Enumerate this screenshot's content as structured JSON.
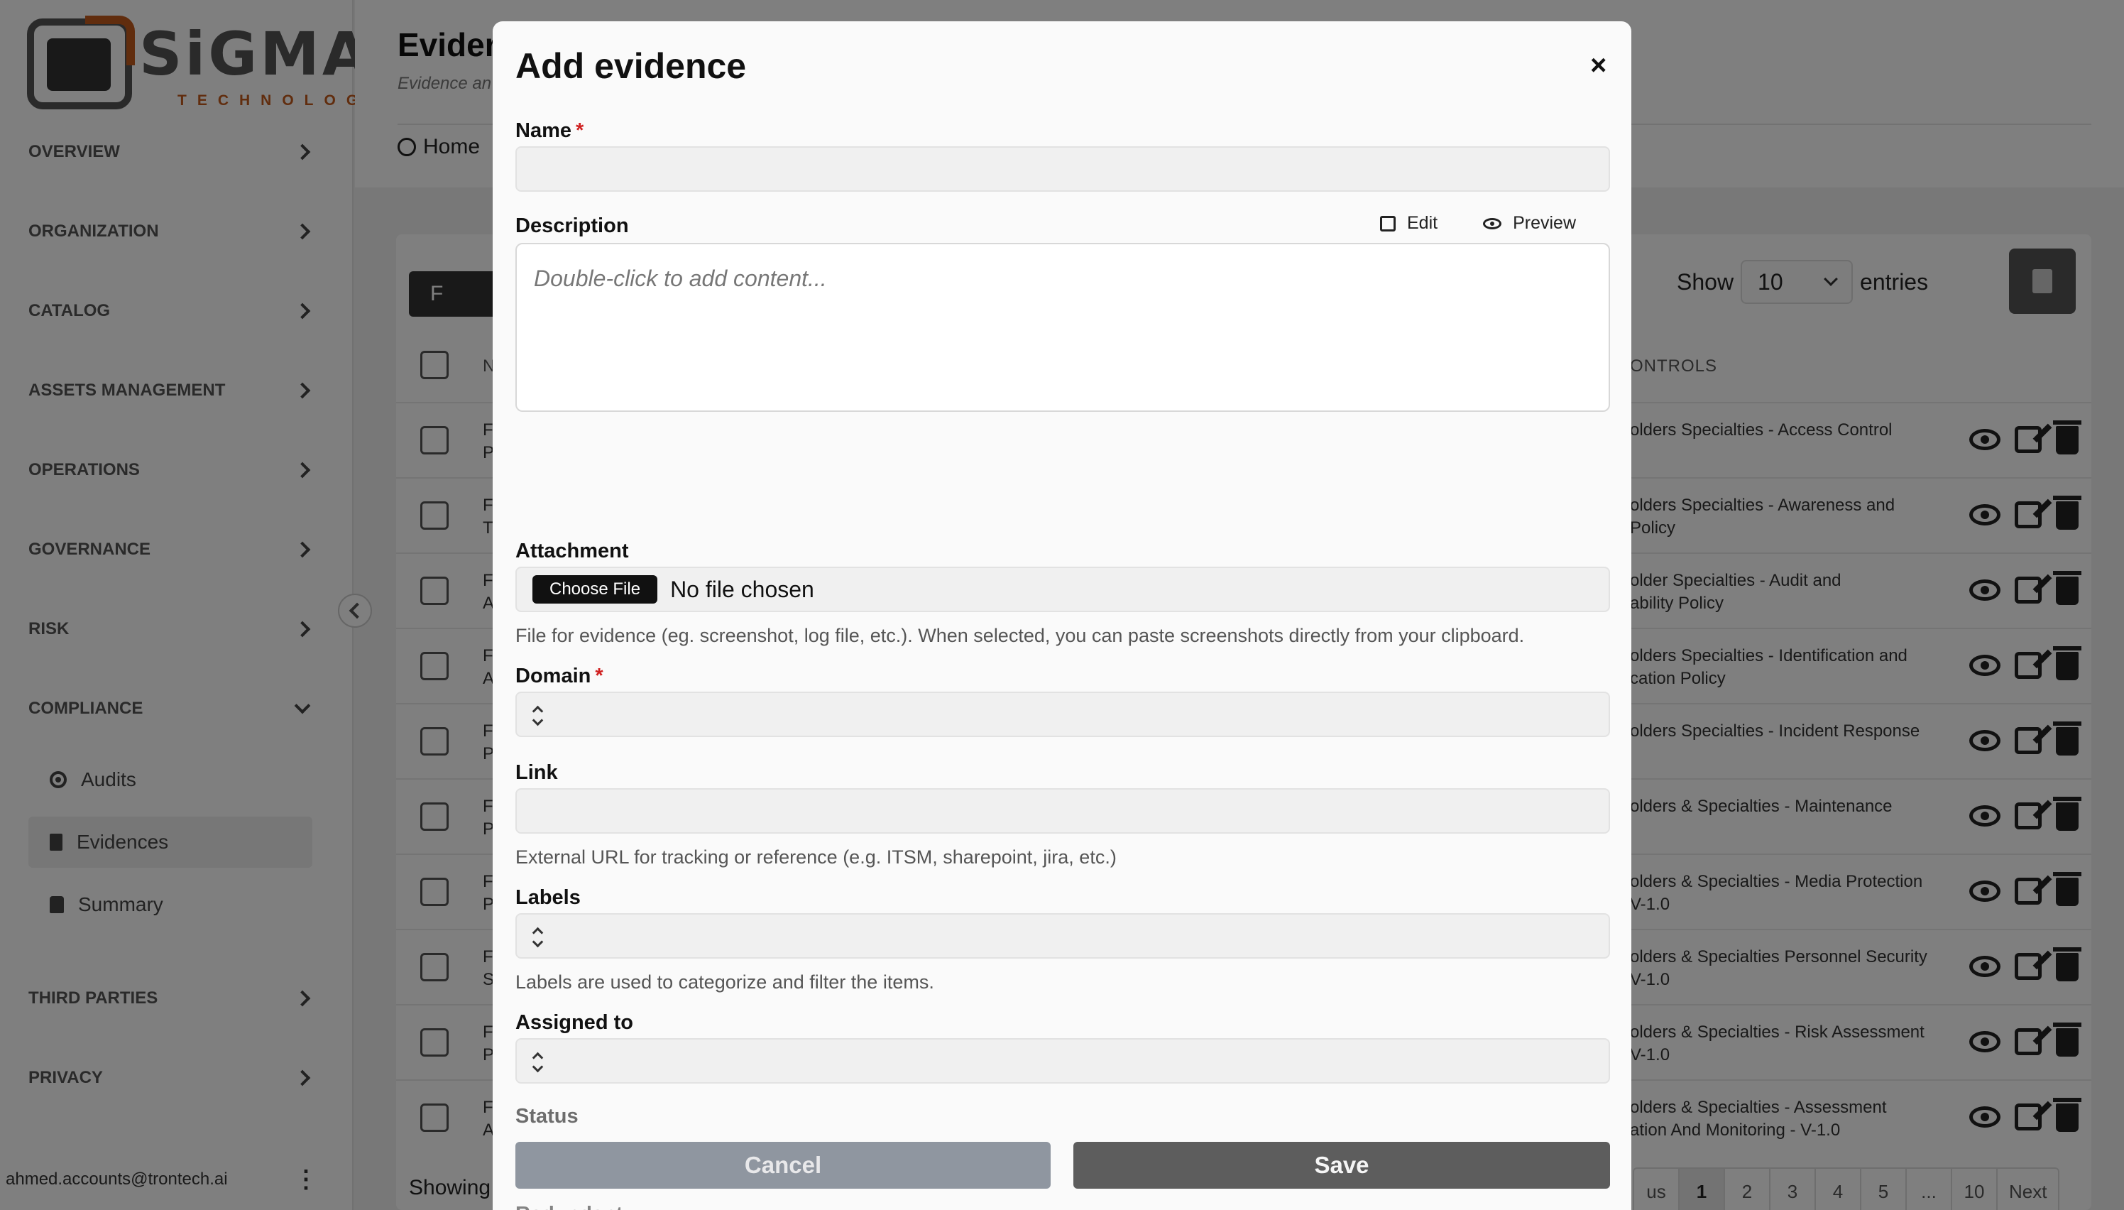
{
  "brand": {
    "name": "SiGMA",
    "sub": "TECHNOLOGY"
  },
  "sidebar": {
    "items": [
      {
        "label": "OVERVIEW"
      },
      {
        "label": "ORGANIZATION"
      },
      {
        "label": "CATALOG"
      },
      {
        "label": "ASSETS MANAGEMENT"
      },
      {
        "label": "OPERATIONS"
      },
      {
        "label": "GOVERNANCE"
      },
      {
        "label": "RISK"
      },
      {
        "label": "COMPLIANCE"
      },
      {
        "label": "THIRD PARTIES"
      },
      {
        "label": "PRIVACY"
      }
    ],
    "compliance_sub": [
      {
        "label": "Audits"
      },
      {
        "label": "Evidences"
      },
      {
        "label": "Summary"
      }
    ],
    "user_email": "ahmed.accounts@trontech.ai"
  },
  "page": {
    "title": "Evider",
    "subtitle": "Evidence an",
    "breadcrumb": "Home"
  },
  "table": {
    "filter_label": "F",
    "show_label": "Show",
    "show_value": "10",
    "entries_label": "entries",
    "col_name": "N",
    "col_controls": "ONTROLS",
    "rows": [
      {
        "n1": "F",
        "n2": "P",
        "c1": "olders Specialties - Access Control",
        "c2": ""
      },
      {
        "n1": "F",
        "n2": "T",
        "c1": "olders Specialties - Awareness and",
        "c2": " Policy"
      },
      {
        "n1": "F",
        "n2": "A",
        "c1": "older Specialties - Audit and",
        "c2": "ability Policy"
      },
      {
        "n1": "F",
        "n2": "A",
        "c1": "olders Specialties - Identification and",
        "c2": "cation Policy"
      },
      {
        "n1": "F",
        "n2": "P",
        "c1": "olders Specialties - Incident Response",
        "c2": ""
      },
      {
        "n1": "F",
        "n2": "P",
        "c1": "olders & Specialties - Maintenance",
        "c2": ""
      },
      {
        "n1": "F",
        "n2": "P",
        "c1": "olders & Specialties - Media Protection",
        "c2": "V-1.0"
      },
      {
        "n1": "F",
        "n2": "S",
        "c1": "olders & Specialties Personnel Security",
        "c2": "V-1.0"
      },
      {
        "n1": "F",
        "n2": "P",
        "c1": "olders & Specialties - Risk Assessment",
        "c2": "V-1.0"
      },
      {
        "n1": "F",
        "n2": "A",
        "c1": "olders & Specialties - Assessment",
        "c2": "ation And Monitoring - V-1.0"
      }
    ],
    "showing": "Showing",
    "pager": [
      "us",
      "1",
      "2",
      "3",
      "4",
      "5",
      "...",
      "10",
      "Next"
    ]
  },
  "modal": {
    "title": "Add evidence",
    "close": "×",
    "name_label": "Name",
    "required_mark": "*",
    "description_label": "Description",
    "edit_label": "Edit",
    "preview_label": "Preview",
    "description_placeholder": "Double-click to add content...",
    "attachment_label": "Attachment",
    "choose_file": "Choose File",
    "no_file": "No file chosen",
    "attachment_help": "File for evidence (eg. screenshot, log file, etc.). When selected, you can paste screenshots directly from your clipboard.",
    "domain_label": "Domain",
    "link_label": "Link",
    "link_help": "External URL for tracking or reference (e.g. ITSM, sharepoint, jira, etc.)",
    "labels_label": "Labels",
    "labels_help": "Labels are used to categorize and filter the items.",
    "assigned_label": "Assigned to",
    "status_label": "Status",
    "below_label": "Redundant",
    "cancel": "Cancel",
    "save": "Save"
  }
}
